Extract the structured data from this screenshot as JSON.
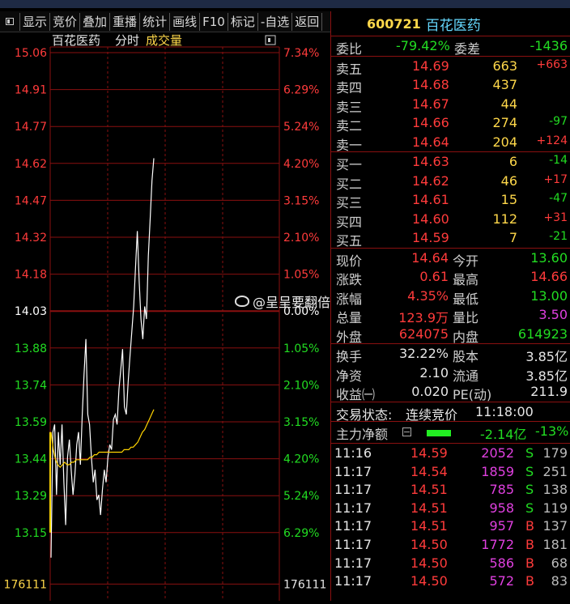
{
  "toolbar": {
    "buttons": [
      "显示",
      "竞价",
      "叠加",
      "重播",
      "统计",
      "画线",
      "F10",
      "标记",
      "-自选",
      "返回"
    ]
  },
  "chart": {
    "title_name": "百花医药",
    "title_mode": "分时",
    "title_indicator": "成交量",
    "price_ticks": [
      "15.06",
      "14.91",
      "14.77",
      "14.62",
      "14.47",
      "14.32",
      "14.18",
      "14.03",
      "13.88",
      "13.74",
      "13.59",
      "13.44",
      "13.29",
      "13.15"
    ],
    "pct_ticks": [
      "7.34%",
      "6.29%",
      "5.24%",
      "4.20%",
      "3.15%",
      "2.10%",
      "1.05%",
      "0.00%",
      "1.05%",
      "2.10%",
      "3.15%",
      "4.20%",
      "5.24%",
      "6.29%"
    ],
    "volume_left": "176111",
    "volume_right": "176111",
    "prev_close": 14.03,
    "price_min": 13.0,
    "price_max": 15.06,
    "price_series": [
      13.05,
      13.55,
      13.58,
      13.3,
      13.55,
      13.42,
      13.58,
      13.35,
      13.18,
      13.45,
      13.52,
      13.4,
      13.3,
      13.38,
      13.5,
      13.55,
      13.42,
      13.62,
      13.78,
      13.92,
      13.62,
      13.58,
      13.45,
      13.35,
      13.4,
      13.28,
      13.3,
      13.22,
      13.32,
      13.4,
      13.35,
      13.45,
      13.5,
      13.48,
      13.6,
      13.62,
      13.58,
      13.72,
      13.8,
      13.88,
      13.65,
      13.62,
      13.75,
      13.85,
      13.95,
      14.05,
      14.2,
      14.35,
      14.15,
      14.0,
      13.92,
      14.05,
      14.0,
      14.25,
      14.4,
      14.55,
      14.64
    ],
    "avg_series": [
      13.55,
      13.48,
      13.44,
      13.42,
      13.41,
      13.42,
      13.43,
      13.42,
      13.42,
      13.43,
      13.43,
      13.44,
      13.44,
      13.44,
      13.44,
      13.44,
      13.44,
      13.45,
      13.45,
      13.46,
      13.46,
      13.47,
      13.47,
      13.47,
      13.47,
      13.47,
      13.47,
      13.47,
      13.47,
      13.47,
      13.47,
      13.47,
      13.48,
      13.48,
      13.48,
      13.49,
      13.49,
      13.5,
      13.51,
      13.53,
      13.55,
      13.56,
      13.58,
      13.6,
      13.62,
      13.64
    ],
    "colors": {
      "grid": "#8a1010",
      "price": "#ffffff",
      "avg": "#ffd400",
      "up": "#ff3b3b",
      "down": "#22dd22"
    }
  },
  "quote": {
    "code": "600721",
    "name": "百花医药",
    "weibi_label": "委比",
    "weibi_value": "-79.42%",
    "weicha_label": "委差",
    "weicha_value": "-1436",
    "asks": [
      {
        "label": "卖五",
        "price": "14.69",
        "vol": "663",
        "chg": "+663"
      },
      {
        "label": "卖四",
        "price": "14.68",
        "vol": "437",
        "chg": ""
      },
      {
        "label": "卖三",
        "price": "14.67",
        "vol": "44",
        "chg": ""
      },
      {
        "label": "卖二",
        "price": "14.66",
        "vol": "274",
        "chg": "-97"
      },
      {
        "label": "卖一",
        "price": "14.64",
        "vol": "204",
        "chg": "+124"
      }
    ],
    "bids": [
      {
        "label": "买一",
        "price": "14.63",
        "vol": "6",
        "chg": "-14"
      },
      {
        "label": "买二",
        "price": "14.62",
        "vol": "46",
        "chg": "+17"
      },
      {
        "label": "买三",
        "price": "14.61",
        "vol": "15",
        "chg": "-47"
      },
      {
        "label": "买四",
        "price": "14.60",
        "vol": "112",
        "chg": "+31"
      },
      {
        "label": "买五",
        "price": "14.59",
        "vol": "7",
        "chg": "-21"
      }
    ],
    "stats1": [
      {
        "l1": "现价",
        "v1": "14.64",
        "l2": "今开",
        "v2": "13.60"
      },
      {
        "l1": "涨跌",
        "v1": "0.61",
        "l2": "最高",
        "v2": "14.66"
      },
      {
        "l1": "涨幅",
        "v1": "4.35%",
        "l2": "最低",
        "v2": "13.00"
      },
      {
        "l1": "总量",
        "v1": "123.9万",
        "l2": "量比",
        "v2": "3.50"
      },
      {
        "l1": "外盘",
        "v1": "624075",
        "l2": "内盘",
        "v2": "614923"
      }
    ],
    "stats2": [
      {
        "l1": "换手",
        "v1": "32.22%",
        "l2": "股本",
        "v2": "3.85亿"
      },
      {
        "l1": "净资",
        "v1": "2.10",
        "l2": "流通",
        "v2": "3.85亿"
      },
      {
        "l1": "收益㈠",
        "v1": "0.020",
        "l2": "PE(动)",
        "v2": "211.9"
      }
    ],
    "status_label": "交易状态:",
    "status_value": "连续竞价",
    "status_time": "11:18:00",
    "flow_label": "主力净额",
    "flow_value": "-2.14亿",
    "flow_pct": "-13%"
  },
  "ticks": [
    {
      "time": "11:16",
      "price": "14.59",
      "vol": "2052",
      "side": "S",
      "num": "179"
    },
    {
      "time": "11:17",
      "price": "14.54",
      "vol": "1859",
      "side": "S",
      "num": "251"
    },
    {
      "time": "11:17",
      "price": "14.51",
      "vol": "785",
      "side": "S",
      "num": "138"
    },
    {
      "time": "11:17",
      "price": "14.51",
      "vol": "958",
      "side": "S",
      "num": "119"
    },
    {
      "time": "11:17",
      "price": "14.51",
      "vol": "957",
      "side": "B",
      "num": "137"
    },
    {
      "time": "11:17",
      "price": "14.50",
      "vol": "1772",
      "side": "B",
      "num": "181"
    },
    {
      "time": "11:17",
      "price": "14.50",
      "vol": "586",
      "side": "B",
      "num": "68"
    },
    {
      "time": "11:17",
      "price": "14.50",
      "vol": "572",
      "side": "B",
      "num": "83"
    }
  ],
  "watermark": "@呈呈要翻倍"
}
